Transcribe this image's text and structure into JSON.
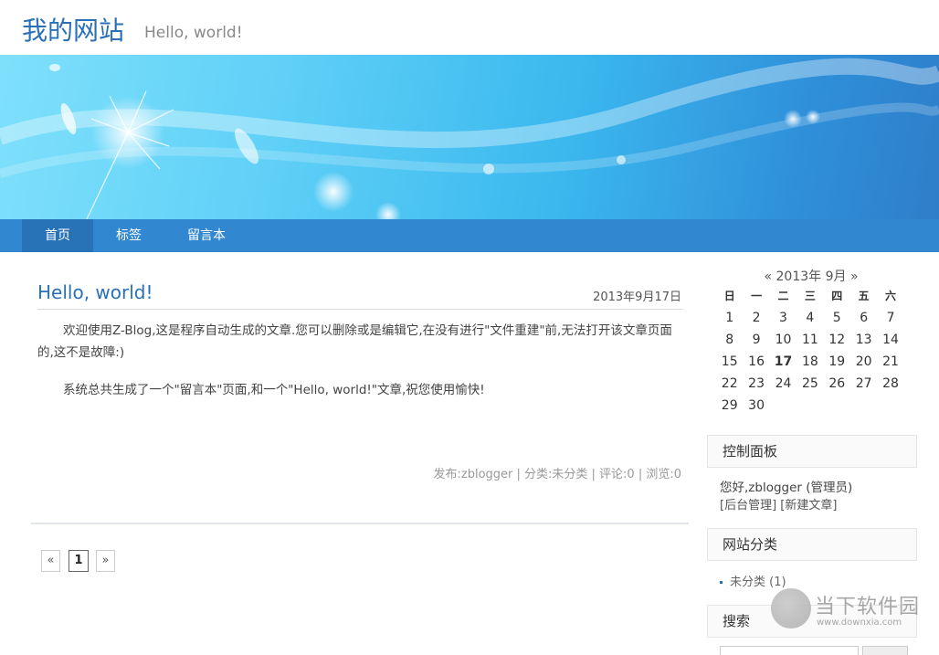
{
  "site": {
    "title": "我的网站",
    "subtitle": "Hello, world!"
  },
  "nav": {
    "items": [
      {
        "label": "首页"
      },
      {
        "label": "标签"
      },
      {
        "label": "留言本"
      }
    ]
  },
  "post": {
    "title": "Hello, world!",
    "date": "2013年9月17日",
    "paragraph1": "欢迎使用Z-Blog,这是程序自动生成的文章.您可以删除或是编辑它,在没有进行\"文件重建\"前,无法打开该文章页面的,这不是故障:)",
    "paragraph2": "系统总共生成了一个\"留言本\"页面,和一个\"Hello, world!\"文章,祝您使用愉快!",
    "meta": "发布:zblogger | 分类:未分类 | 评论:0 | 浏览:0"
  },
  "pagination": {
    "prev": "«",
    "current": "1",
    "next": "»"
  },
  "calendar": {
    "prev": "«",
    "month_label": "2013年 9月",
    "next": "»",
    "weekdays": [
      "日",
      "一",
      "二",
      "三",
      "四",
      "五",
      "六"
    ],
    "weeks": [
      [
        "1",
        "2",
        "3",
        "4",
        "5",
        "6",
        "7"
      ],
      [
        "8",
        "9",
        "10",
        "11",
        "12",
        "13",
        "14"
      ],
      [
        "15",
        "16",
        "17",
        "18",
        "19",
        "20",
        "21"
      ],
      [
        "22",
        "23",
        "24",
        "25",
        "26",
        "27",
        "28"
      ],
      [
        "29",
        "30",
        "",
        "",
        "",
        "",
        ""
      ]
    ],
    "today": "17"
  },
  "control_panel": {
    "title": "控制面板",
    "greeting": "您好,zblogger (管理员)",
    "links": [
      "[后台管理]",
      "[新建文章]"
    ]
  },
  "categories": {
    "title": "网站分类",
    "items": [
      {
        "label": "未分类 (1)"
      }
    ]
  },
  "search": {
    "title": "搜索"
  },
  "watermark": {
    "name": "当下软件园",
    "url": "www.downxia.com"
  },
  "colors": {
    "accent": "#2a70b8",
    "nav": "#3288d0",
    "nav_active": "#2873b8"
  }
}
